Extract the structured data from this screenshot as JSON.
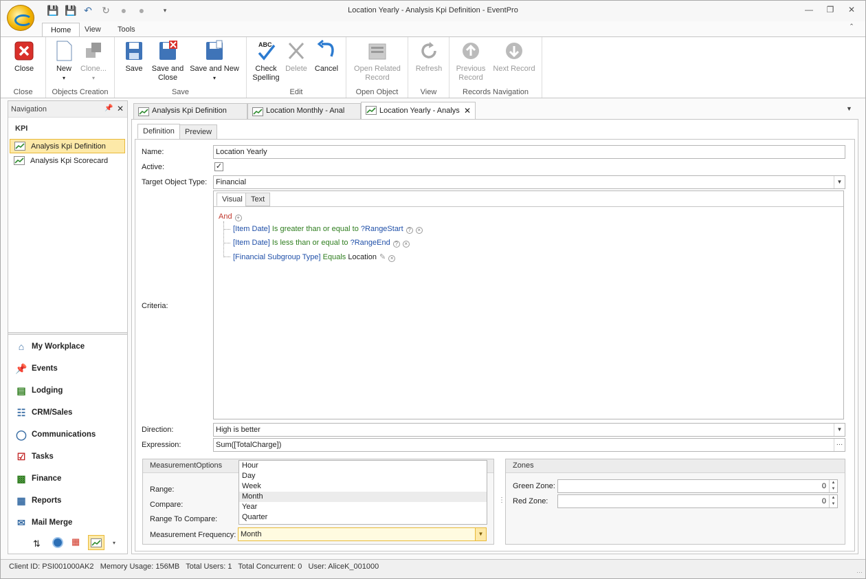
{
  "app": {
    "title": "Location Yearly - Analysis Kpi Definition - EventPro"
  },
  "ribbon": {
    "tabs": [
      "Home",
      "View",
      "Tools"
    ],
    "groups": {
      "close": {
        "label": "Close",
        "buttons": {
          "close": "Close"
        }
      },
      "objects": {
        "label": "Objects Creation",
        "buttons": {
          "new": "New",
          "clone": "Clone..."
        }
      },
      "save": {
        "label": "Save",
        "buttons": {
          "save": "Save",
          "save_close_1": "Save and",
          "save_close_2": "Close",
          "save_new": "Save and New"
        }
      },
      "edit": {
        "label": "Edit",
        "buttons": {
          "check_1": "Check",
          "check_2": "Spelling",
          "delete": "Delete",
          "cancel": "Cancel"
        }
      },
      "open": {
        "label": "Open Object",
        "buttons": {
          "open_1": "Open Related",
          "open_2": "Record"
        }
      },
      "view": {
        "label": "View",
        "buttons": {
          "refresh": "Refresh"
        }
      },
      "records": {
        "label": "Records Navigation",
        "buttons": {
          "prev_1": "Previous",
          "prev_2": "Record",
          "next": "Next Record"
        }
      }
    }
  },
  "nav": {
    "header": "Navigation",
    "section": "KPI",
    "items": [
      "Analysis Kpi Definition",
      "Analysis Kpi Scorecard"
    ],
    "modules": [
      "My Workplace",
      "Events",
      "Lodging",
      "CRM/Sales",
      "Communications",
      "Tasks",
      "Finance",
      "Reports",
      "Mail Merge"
    ]
  },
  "doc_tabs": [
    "Analysis Kpi Definition",
    "Location Monthly - Anal",
    "Location Yearly - Analys"
  ],
  "form": {
    "subtabs": [
      "Definition",
      "Preview"
    ],
    "name_label": "Name:",
    "name_value": "Location Yearly",
    "active_label": "Active:",
    "active_checked": true,
    "target_label": "Target Object Type:",
    "target_value": "Financial",
    "criteria_label": "Criteria:",
    "criteria_tabs": [
      "Visual",
      "Text"
    ],
    "criteria": {
      "root": "And",
      "rows": [
        {
          "field": "[Item Date]",
          "op": "Is greater than or equal to",
          "value": "?RangeStart"
        },
        {
          "field": "[Item Date]",
          "op": "Is less than or equal to",
          "value": "?RangeEnd"
        },
        {
          "field": "[Financial Subgroup Type]",
          "op": "Equals",
          "value": "Location"
        }
      ]
    },
    "direction_label": "Direction:",
    "direction_value": "High is better",
    "expression_label": "Expression:",
    "expression_value": "Sum([TotalCharge])",
    "measurement": {
      "title": "MeasurementOptions",
      "range_label": "Range:",
      "compare_label": "Compare:",
      "range_to_compare_label": "Range To Compare:",
      "frequency_label": "Measurement Frequency:",
      "frequency_value": "Month",
      "options": [
        "Hour",
        "Day",
        "Week",
        "Month",
        "Year",
        "Quarter"
      ],
      "highlighted": "Month"
    },
    "zones": {
      "title": "Zones",
      "green_label": "Green Zone:",
      "green_value": "0",
      "red_label": "Red Zone:",
      "red_value": "0"
    }
  },
  "status": {
    "text": "Client ID: PSI001000AK2   Memory Usage: 156MB   Total Users: 1   Total Concurrent: 0   User: AliceK_001000"
  },
  "colors": {
    "accent": "#e8b93a",
    "selection": "#fde9a8",
    "link_blue": "#1f4fa8",
    "op_green": "#2e7d1e",
    "and_red": "#c0362c"
  }
}
